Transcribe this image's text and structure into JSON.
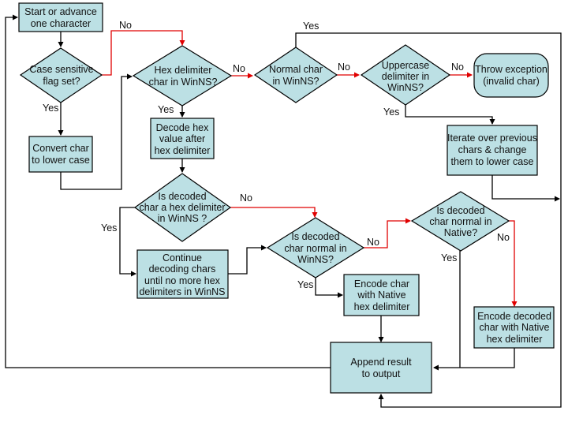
{
  "nodes": {
    "start": [
      "Start or advance",
      "one character"
    ],
    "case_sensitive": [
      "Case sensitive",
      "flag set?"
    ],
    "convert_lower": [
      "Convert char",
      "to lower case"
    ],
    "hex_delim": [
      "Hex delimiter",
      "char in WinNS?"
    ],
    "decode_hex": [
      "Decode hex",
      "value after",
      "hex delimiter"
    ],
    "normal_char": [
      "Normal char",
      "in WinNS?"
    ],
    "uppercase_delim": [
      "Uppercase",
      "delimiter in",
      "WinNS?"
    ],
    "throw_exception": [
      "Throw exception",
      "(invalid char)"
    ],
    "iterate_lower": [
      "Iterate over previous",
      "chars & change",
      "them to lower case"
    ],
    "decoded_hex_delim": [
      "Is decoded",
      "char a hex delimiter",
      "in WinNS ?"
    ],
    "continue_decoding": [
      "Continue",
      "decoding chars",
      "until no more hex",
      "delimiters in WinNS"
    ],
    "decoded_normal_winns": [
      "Is decoded",
      "char normal in",
      "WinNS?"
    ],
    "decoded_normal_native": [
      "Is decoded",
      "char normal in",
      "Native?"
    ],
    "encode_native": [
      "Encode char",
      "with Native",
      "hex delimiter"
    ],
    "encode_decoded_native": [
      "Encode decoded",
      "char with Native",
      "hex delimiter"
    ],
    "append_output": [
      "Append result",
      "to output"
    ]
  },
  "edge_labels": {
    "case_no": "No",
    "case_yes": "Yes",
    "hex_no": "No",
    "hex_yes": "Yes",
    "normal_yes": "Yes",
    "normal_no": "No",
    "upper_no": "No",
    "upper_yes": "Yes",
    "dec_hex_no": "No",
    "dec_hex_yes": "Yes",
    "dec_winns_no": "No",
    "dec_winns_yes": "Yes",
    "dec_native_no": "No",
    "dec_native_yes": "Yes"
  },
  "colors": {
    "shape_fill": "#bce0e4",
    "no_branch": "#e00000",
    "line": "#000000"
  }
}
